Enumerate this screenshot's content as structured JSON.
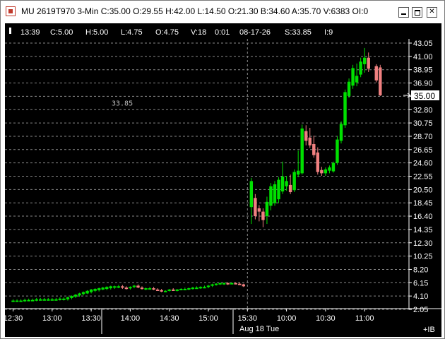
{
  "title": "MU 2619T970 3-Min C:35.00 O:29.55 H:42.00 L:14.50 O:21.30 B:34.60 A:35.70 V:6383 OI:0",
  "status": {
    "time": "13:39",
    "close": "C:5.00",
    "high": "H:5.00",
    "low": "L:4.75",
    "open": "O:4.75",
    "volume": "V:18",
    "interval": "0:01",
    "date": "08-17-26",
    "s": "S:33.85",
    "i": "I:9"
  },
  "ref_label": "33.85",
  "last_price_label": "35.00",
  "corner_label": "+IB",
  "date_caption": "Aug 18 Tue",
  "colors": {
    "up": "#00e000",
    "down": "#f08080",
    "background": "#000000",
    "grid": "#8a8a8a"
  },
  "icons": [
    "chart-app-icon",
    "minimize-icon",
    "maximize-icon",
    "close-icon",
    "last-price-arrow-icon"
  ],
  "chart_data": {
    "type": "candlestick",
    "y_ticks": [
      "43.05",
      "41.00",
      "38.95",
      "36.90",
      "35.00",
      "32.80",
      "30.75",
      "28.70",
      "26.65",
      "24.60",
      "22.55",
      "20.50",
      "18.45",
      "16.40",
      "14.35",
      "12.30",
      "10.25",
      "8.20",
      "6.15",
      "4.10",
      "2.05"
    ],
    "ylim": [
      1.5,
      44.0
    ],
    "x_ticks": [
      {
        "label": "12:30",
        "x": 1
      },
      {
        "label": "13:00",
        "x": 11
      },
      {
        "label": "13:30",
        "x": 21
      },
      {
        "label": "14:00",
        "x": 31
      },
      {
        "label": "14:30",
        "x": 41
      },
      {
        "label": "15:00",
        "x": 51
      },
      {
        "label": "15:30",
        "x": 61
      },
      {
        "label": "10:00",
        "x": 71
      },
      {
        "label": "10:30",
        "x": 81
      },
      {
        "label": "11:00",
        "x": 91
      }
    ],
    "session_break_x": 61,
    "xlim": [
      0,
      102
    ],
    "reference_level": 33.85,
    "last_price": 35.0,
    "candles": [
      {
        "x": 1,
        "o": 3.4,
        "h": 3.6,
        "l": 3.2,
        "c": 3.4
      },
      {
        "x": 2,
        "o": 3.4,
        "h": 3.6,
        "l": 3.2,
        "c": 3.4
      },
      {
        "x": 3,
        "o": 3.4,
        "h": 3.6,
        "l": 3.2,
        "c": 3.4
      },
      {
        "x": 4,
        "o": 3.4,
        "h": 3.7,
        "l": 3.2,
        "c": 3.5
      },
      {
        "x": 5,
        "o": 3.5,
        "h": 3.7,
        "l": 3.3,
        "c": 3.5
      },
      {
        "x": 6,
        "o": 3.5,
        "h": 3.7,
        "l": 3.3,
        "c": 3.5
      },
      {
        "x": 7,
        "o": 3.5,
        "h": 3.8,
        "l": 3.3,
        "c": 3.6
      },
      {
        "x": 8,
        "o": 3.6,
        "h": 3.8,
        "l": 3.4,
        "c": 3.6
      },
      {
        "x": 9,
        "o": 3.6,
        "h": 3.8,
        "l": 3.4,
        "c": 3.6
      },
      {
        "x": 10,
        "o": 3.6,
        "h": 3.8,
        "l": 3.4,
        "c": 3.6
      },
      {
        "x": 11,
        "o": 3.6,
        "h": 3.8,
        "l": 3.4,
        "c": 3.6
      },
      {
        "x": 12,
        "o": 3.6,
        "h": 3.8,
        "l": 3.4,
        "c": 3.6
      },
      {
        "x": 13,
        "o": 3.6,
        "h": 3.9,
        "l": 3.4,
        "c": 3.7
      },
      {
        "x": 14,
        "o": 3.6,
        "h": 3.9,
        "l": 3.4,
        "c": 3.7
      },
      {
        "x": 15,
        "o": 3.6,
        "h": 4.0,
        "l": 3.4,
        "c": 3.9
      },
      {
        "x": 16,
        "o": 3.8,
        "h": 4.2,
        "l": 3.6,
        "c": 4.1
      },
      {
        "x": 17,
        "o": 4.0,
        "h": 4.4,
        "l": 3.8,
        "c": 4.3
      },
      {
        "x": 18,
        "o": 4.2,
        "h": 4.6,
        "l": 4.0,
        "c": 4.5
      },
      {
        "x": 19,
        "o": 4.4,
        "h": 4.8,
        "l": 4.2,
        "c": 4.7
      },
      {
        "x": 20,
        "o": 4.5,
        "h": 5.0,
        "l": 4.4,
        "c": 4.9
      },
      {
        "x": 21,
        "o": 4.7,
        "h": 5.2,
        "l": 4.5,
        "c": 5.1
      },
      {
        "x": 22,
        "o": 4.9,
        "h": 5.3,
        "l": 4.7,
        "c": 5.2
      },
      {
        "x": 23,
        "o": 5.0,
        "h": 5.4,
        "l": 4.8,
        "c": 5.3
      },
      {
        "x": 24,
        "o": 5.1,
        "h": 5.5,
        "l": 5.0,
        "c": 5.4
      },
      {
        "x": 25,
        "o": 5.2,
        "h": 5.6,
        "l": 5.0,
        "c": 5.5
      },
      {
        "x": 26,
        "o": 5.3,
        "h": 5.7,
        "l": 5.1,
        "c": 5.6
      },
      {
        "x": 27,
        "o": 5.4,
        "h": 5.7,
        "l": 5.2,
        "c": 5.6
      },
      {
        "x": 28,
        "o": 5.5,
        "h": 5.8,
        "l": 5.3,
        "c": 5.6
      },
      {
        "x": 29,
        "o": 5.6,
        "h": 5.8,
        "l": 5.2,
        "c": 5.4
      },
      {
        "x": 30,
        "o": 5.4,
        "h": 5.6,
        "l": 5.1,
        "c": 5.3
      },
      {
        "x": 31,
        "o": 5.3,
        "h": 5.6,
        "l": 5.1,
        "c": 5.5
      },
      {
        "x": 32,
        "o": 5.5,
        "h": 5.8,
        "l": 5.3,
        "c": 5.7
      },
      {
        "x": 33,
        "o": 5.7,
        "h": 5.9,
        "l": 5.3,
        "c": 5.4
      },
      {
        "x": 34,
        "o": 5.4,
        "h": 5.6,
        "l": 5.1,
        "c": 5.2
      },
      {
        "x": 35,
        "o": 5.2,
        "h": 5.4,
        "l": 5.0,
        "c": 5.3
      },
      {
        "x": 36,
        "o": 5.3,
        "h": 5.5,
        "l": 5.1,
        "c": 5.3
      },
      {
        "x": 37,
        "o": 5.3,
        "h": 5.5,
        "l": 5.0,
        "c": 5.1
      },
      {
        "x": 38,
        "o": 5.1,
        "h": 5.3,
        "l": 4.9,
        "c": 5.0
      },
      {
        "x": 39,
        "o": 5.0,
        "h": 5.2,
        "l": 4.7,
        "c": 4.8
      },
      {
        "x": 40,
        "o": 4.8,
        "h": 5.0,
        "l": 4.7,
        "c": 4.9
      },
      {
        "x": 41,
        "o": 4.9,
        "h": 5.2,
        "l": 4.8,
        "c": 5.1
      },
      {
        "x": 42,
        "o": 5.1,
        "h": 5.3,
        "l": 4.9,
        "c": 5.0
      },
      {
        "x": 43,
        "o": 5.0,
        "h": 5.2,
        "l": 4.8,
        "c": 5.1
      },
      {
        "x": 44,
        "o": 5.1,
        "h": 5.3,
        "l": 5.0,
        "c": 5.2
      },
      {
        "x": 45,
        "o": 5.2,
        "h": 5.4,
        "l": 5.0,
        "c": 5.2
      },
      {
        "x": 46,
        "o": 5.2,
        "h": 5.4,
        "l": 5.0,
        "c": 5.3
      },
      {
        "x": 47,
        "o": 5.3,
        "h": 5.5,
        "l": 5.1,
        "c": 5.4
      },
      {
        "x": 48,
        "o": 5.4,
        "h": 5.6,
        "l": 5.2,
        "c": 5.4
      },
      {
        "x": 49,
        "o": 5.4,
        "h": 5.6,
        "l": 5.2,
        "c": 5.5
      },
      {
        "x": 50,
        "o": 5.5,
        "h": 5.7,
        "l": 5.3,
        "c": 5.5
      },
      {
        "x": 51,
        "o": 5.5,
        "h": 5.8,
        "l": 5.3,
        "c": 5.7
      },
      {
        "x": 52,
        "o": 5.7,
        "h": 6.0,
        "l": 5.5,
        "c": 5.9
      },
      {
        "x": 53,
        "o": 5.9,
        "h": 6.1,
        "l": 5.7,
        "c": 6.0
      },
      {
        "x": 54,
        "o": 6.0,
        "h": 6.2,
        "l": 5.8,
        "c": 6.1
      },
      {
        "x": 55,
        "o": 6.0,
        "h": 6.2,
        "l": 5.8,
        "c": 6.1
      },
      {
        "x": 56,
        "o": 6.1,
        "h": 6.2,
        "l": 5.8,
        "c": 6.0
      },
      {
        "x": 57,
        "o": 6.0,
        "h": 6.2,
        "l": 5.9,
        "c": 6.1
      },
      {
        "x": 58,
        "o": 6.1,
        "h": 6.2,
        "l": 5.9,
        "c": 6.0
      },
      {
        "x": 59,
        "o": 6.0,
        "h": 6.2,
        "l": 5.8,
        "c": 5.9
      },
      {
        "x": 60,
        "o": 5.9,
        "h": 6.0,
        "l": 5.5,
        "c": 5.6
      },
      {
        "x": 62,
        "o": 17.8,
        "h": 22.3,
        "l": 15.2,
        "c": 21.8
      },
      {
        "x": 63,
        "o": 19.2,
        "h": 19.8,
        "l": 15.9,
        "c": 16.4
      },
      {
        "x": 64,
        "o": 17.6,
        "h": 18.1,
        "l": 15.6,
        "c": 17.1
      },
      {
        "x": 65,
        "o": 17.1,
        "h": 17.6,
        "l": 14.7,
        "c": 15.8
      },
      {
        "x": 66,
        "o": 16.4,
        "h": 19.4,
        "l": 15.2,
        "c": 18.6
      },
      {
        "x": 67,
        "o": 18.0,
        "h": 21.5,
        "l": 17.3,
        "c": 21.0
      },
      {
        "x": 68,
        "o": 18.4,
        "h": 21.8,
        "l": 18.0,
        "c": 21.3
      },
      {
        "x": 69,
        "o": 19.0,
        "h": 22.4,
        "l": 18.4,
        "c": 22.0
      },
      {
        "x": 70,
        "o": 20.2,
        "h": 24.8,
        "l": 19.8,
        "c": 22.5
      },
      {
        "x": 71,
        "o": 21.0,
        "h": 22.6,
        "l": 20.3,
        "c": 21.8
      },
      {
        "x": 72,
        "o": 21.2,
        "h": 22.8,
        "l": 19.8,
        "c": 20.1
      },
      {
        "x": 73,
        "o": 20.4,
        "h": 23.6,
        "l": 20.1,
        "c": 23.2
      },
      {
        "x": 74,
        "o": 22.8,
        "h": 26.5,
        "l": 22.4,
        "c": 23.4
      },
      {
        "x": 75,
        "o": 23.0,
        "h": 30.5,
        "l": 22.8,
        "c": 29.9
      },
      {
        "x": 76,
        "o": 29.5,
        "h": 30.4,
        "l": 27.3,
        "c": 28.0
      },
      {
        "x": 77,
        "o": 28.5,
        "h": 30.0,
        "l": 26.9,
        "c": 27.3
      },
      {
        "x": 78,
        "o": 27.5,
        "h": 28.8,
        "l": 25.4,
        "c": 25.8
      },
      {
        "x": 79,
        "o": 26.2,
        "h": 27.0,
        "l": 22.8,
        "c": 23.2
      },
      {
        "x": 80,
        "o": 23.5,
        "h": 24.0,
        "l": 22.6,
        "c": 23.0
      },
      {
        "x": 81,
        "o": 23.0,
        "h": 23.9,
        "l": 22.6,
        "c": 23.6
      },
      {
        "x": 82,
        "o": 23.4,
        "h": 24.2,
        "l": 23.0,
        "c": 23.9
      },
      {
        "x": 83,
        "o": 23.3,
        "h": 24.8,
        "l": 23.1,
        "c": 24.6
      },
      {
        "x": 84,
        "o": 24.6,
        "h": 28.7,
        "l": 24.3,
        "c": 28.2
      },
      {
        "x": 85,
        "o": 28.0,
        "h": 31.0,
        "l": 27.6,
        "c": 30.6
      },
      {
        "x": 86,
        "o": 30.4,
        "h": 35.9,
        "l": 30.0,
        "c": 35.5
      },
      {
        "x": 87,
        "o": 34.9,
        "h": 37.6,
        "l": 34.6,
        "c": 37.1
      },
      {
        "x": 88,
        "o": 36.5,
        "h": 39.7,
        "l": 36.0,
        "c": 39.2
      },
      {
        "x": 89,
        "o": 37.0,
        "h": 39.9,
        "l": 36.4,
        "c": 38.0
      },
      {
        "x": 90,
        "o": 38.2,
        "h": 40.8,
        "l": 37.8,
        "c": 40.2
      },
      {
        "x": 91,
        "o": 39.8,
        "h": 42.3,
        "l": 38.5,
        "c": 40.8
      },
      {
        "x": 92,
        "o": 40.8,
        "h": 41.6,
        "l": 38.6,
        "c": 39.1
      },
      {
        "x": 94,
        "o": 39.5,
        "h": 39.8,
        "l": 37.0,
        "c": 37.3
      },
      {
        "x": 95,
        "o": 39.3,
        "h": 39.7,
        "l": 34.9,
        "c": 35.0
      }
    ]
  }
}
